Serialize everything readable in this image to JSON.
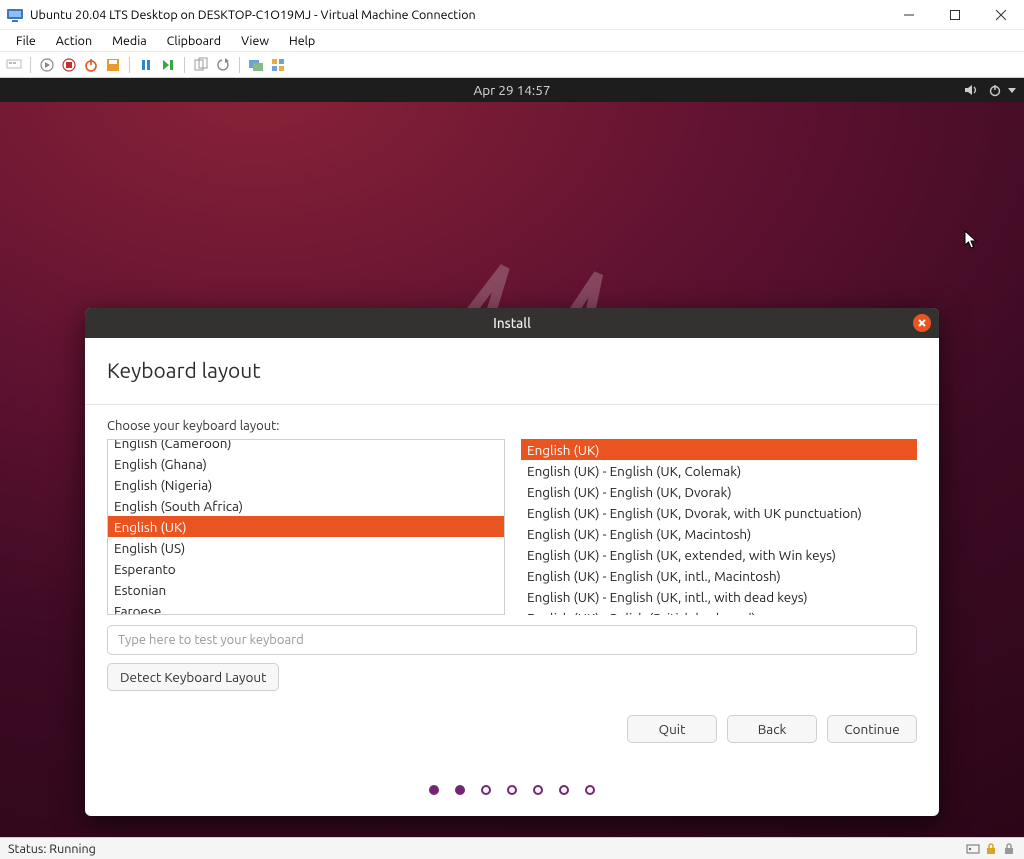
{
  "host": {
    "title": "Ubuntu 20.04 LTS Desktop on DESKTOP-C1O19MJ - Virtual Machine Connection",
    "menu": [
      "File",
      "Action",
      "Media",
      "Clipboard",
      "View",
      "Help"
    ],
    "status": "Status: Running"
  },
  "gnome": {
    "clock": "Apr 29  14:57"
  },
  "installer": {
    "title": "Install",
    "heading": "Keyboard layout",
    "subtitle": "Choose your keyboard layout:",
    "left_list": [
      "English (Cameroon)",
      "English (Ghana)",
      "English (Nigeria)",
      "English (South Africa)",
      "English (UK)",
      "English (US)",
      "Esperanto",
      "Estonian",
      "Faroese"
    ],
    "left_selected_index": 4,
    "right_list": [
      "English (UK)",
      "English (UK) - English (UK, Colemak)",
      "English (UK) - English (UK, Dvorak)",
      "English (UK) - English (UK, Dvorak, with UK punctuation)",
      "English (UK) - English (UK, Macintosh)",
      "English (UK) - English (UK, extended, with Win keys)",
      "English (UK) - English (UK, intl., Macintosh)",
      "English (UK) - English (UK, intl., with dead keys)",
      "English (UK) - Polish (British keyboard)"
    ],
    "right_selected_index": 0,
    "test_placeholder": "Type here to test your keyboard",
    "detect_label": "Detect Keyboard Layout",
    "quit_label": "Quit",
    "back_label": "Back",
    "continue_label": "Continue",
    "progress_total": 7,
    "progress_filled": 2
  }
}
